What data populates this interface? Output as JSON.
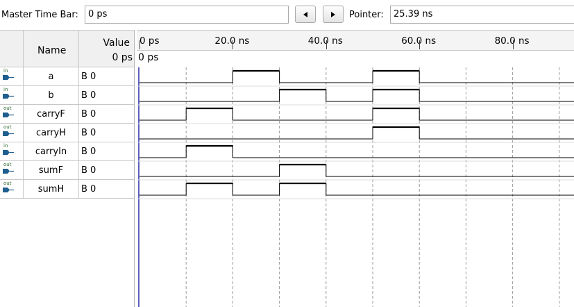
{
  "toolbar": {
    "master_time_bar_label": "Master Time Bar:",
    "master_time_bar_value": "0 ps",
    "prev_icon": "triangle-left-icon",
    "next_icon": "triangle-right-icon",
    "pointer_label": "Pointer:",
    "pointer_value": "25.39 ns"
  },
  "table": {
    "name_header": "Name",
    "value_header": "Value",
    "value_at_time": "0 ps",
    "cursor_time": "0 ps",
    "signals": [
      {
        "name": "a",
        "direction": "in",
        "value": "B 0"
      },
      {
        "name": "b",
        "direction": "in",
        "value": "B 0"
      },
      {
        "name": "carryF",
        "direction": "out",
        "value": "B 0"
      },
      {
        "name": "carryH",
        "direction": "out",
        "value": "B 0"
      },
      {
        "name": "carryIn",
        "direction": "in",
        "value": "B 0"
      },
      {
        "name": "sumF",
        "direction": "out",
        "value": "B 0"
      },
      {
        "name": "sumH",
        "direction": "out",
        "value": "B 0"
      }
    ]
  },
  "timeline": {
    "tick_labels": [
      "0 ps",
      "20.0 ns",
      "40.0 ns",
      "60.0 ns",
      "80.0 ns"
    ],
    "grid_step_ns": 10,
    "time_start_ns": 0,
    "time_visible_end_ns": 93
  },
  "waveforms": {
    "a": [
      [
        20,
        30
      ],
      [
        50,
        60
      ]
    ],
    "b": [
      [
        30,
        40
      ],
      [
        50,
        60
      ]
    ],
    "carryF": [
      [
        10,
        20
      ],
      [
        50,
        60
      ]
    ],
    "carryH": [
      [
        50,
        60
      ]
    ],
    "carryIn": [
      [
        10,
        20
      ]
    ],
    "sumF": [
      [
        30,
        40
      ]
    ],
    "sumH": [
      [
        10,
        20
      ],
      [
        30,
        40
      ]
    ]
  },
  "colors": {
    "input_icon": "#1f5f8f",
    "output_icon": "#1f5f8f",
    "cursor_line": "#2a2aa8",
    "wave": "#000000",
    "grid": "#9a9a9a"
  }
}
